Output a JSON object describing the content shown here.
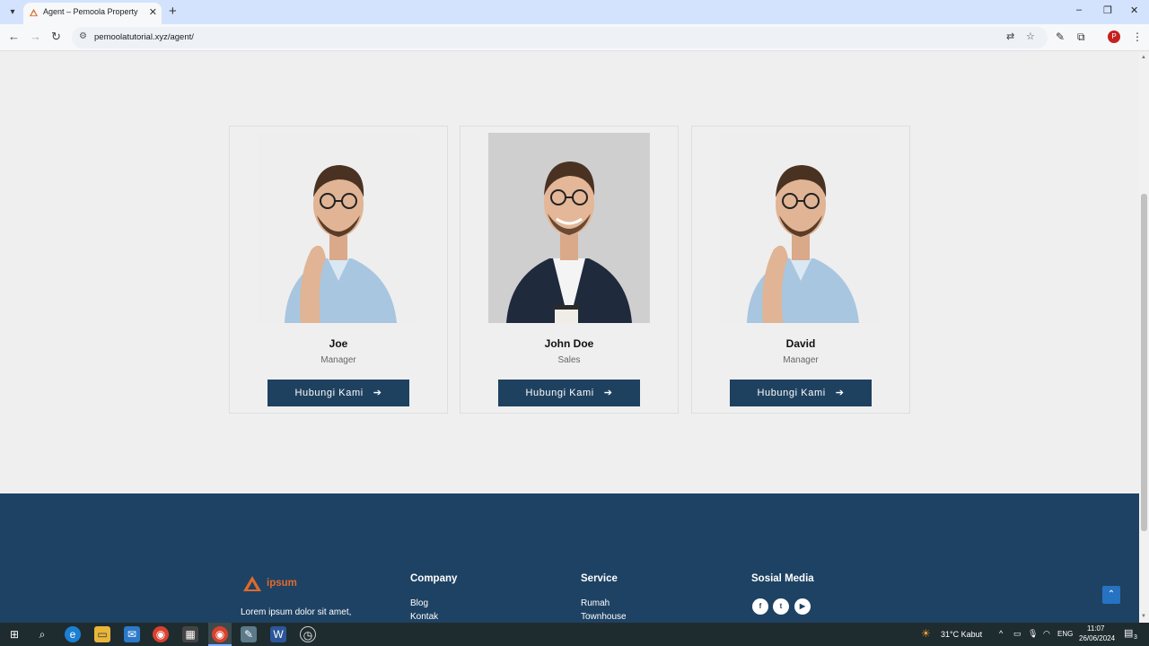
{
  "browser": {
    "tab_title": "Agent – Pemoola Property",
    "tab_close": "✕",
    "new_tab": "+",
    "url": "pemoolatutorial.xyz/agent/",
    "profile_initial": "P",
    "window_controls": [
      "–",
      "❐",
      "✕"
    ]
  },
  "agents": [
    {
      "name": "Joe",
      "role": "Manager",
      "button": "Hubungi Kami",
      "photo": "man-glasses-casual-shirt"
    },
    {
      "name": "John Doe",
      "role": "Sales",
      "button": "Hubungi Kami",
      "photo": "man-glasses-suit"
    },
    {
      "name": "David",
      "role": "Manager",
      "button": "Hubungi Kami",
      "photo": "man-glasses-casual-shirt"
    }
  ],
  "footer": {
    "brand_part1": "",
    "brand_part2": "ipsum",
    "text_line1": "Lorem ipsum dolor sit amet,",
    "company": {
      "heading": "Company",
      "links": [
        "Blog",
        "Kontak"
      ]
    },
    "service": {
      "heading": "Service",
      "links": [
        "Rumah",
        "Townhouse"
      ]
    },
    "social": {
      "heading": "Sosial Media",
      "icons": [
        "facebook-icon",
        "twitter-icon",
        "youtube-icon"
      ]
    },
    "social_glyphs": [
      "f",
      "t",
      "▶"
    ]
  },
  "taskbar": {
    "weather": "31°C  Kabut",
    "language": "ENG",
    "time": "11:07",
    "date": "26/06/2024",
    "notification_count": "3"
  },
  "colors": {
    "footer_bg": "#1e4263",
    "button_bg": "#1f4160",
    "brand_accent": "#e06a2c",
    "back_to_top": "#2573c2"
  }
}
